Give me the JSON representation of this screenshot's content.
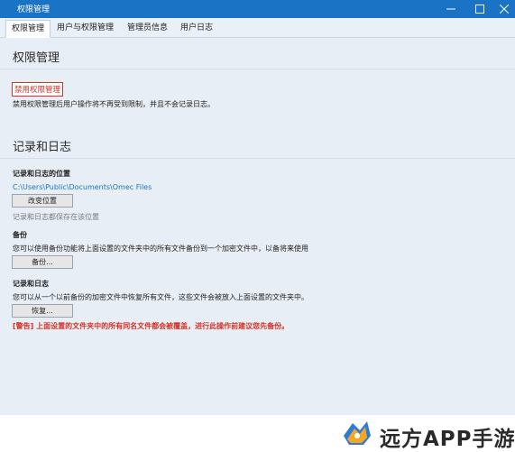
{
  "window": {
    "title": "权限管理"
  },
  "tabs": [
    "权限管理",
    "用户与权限管理",
    "管理员信息",
    "用户日志"
  ],
  "permissions": {
    "heading": "权限管理",
    "disable_label": "禁用权限管理",
    "description": "禁用权限管理后用户操作将不再受到限制，并且不会记录日志。"
  },
  "logs": {
    "heading": "记录和日志",
    "location_label": "记录和日志的位置",
    "path": "C:\\Users\\Public\\Documents\\Omec Files",
    "change_button": "改变位置",
    "location_note": "记录和日志都保存在该位置",
    "backup_label": "备份",
    "backup_desc": "您可以使用备份功能将上面设置的文件夹中的所有文件备份到一个加密文件中，以备将来使用",
    "backup_button": "备份...",
    "restore_label": "记录和日志",
    "restore_desc": "您可以从一个以前备份的加密文件中恢复所有文件，这些文件会被放入上面设置的文件夹中。",
    "restore_button": "恢复...",
    "warning": "[警告] 上面设置的文件夹中的所有同名文件都会被覆盖，进行此操作前建议您先备份。"
  },
  "watermark": {
    "text": "远方APP手游网",
    "icon": "watermark-logo-icon"
  },
  "colors": {
    "titlebar": "#1a73c4",
    "accent_red": "#d93025",
    "link": "#1a73c4"
  }
}
